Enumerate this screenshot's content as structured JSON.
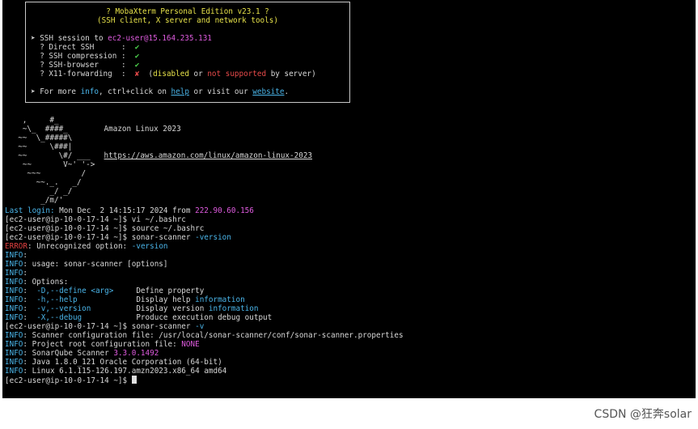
{
  "banner": {
    "title": "? MobaXterm Personal Edition v23.1 ?",
    "subtitle": "(SSH client, X server and network tools)",
    "session_prefix": "➤ SSH session to ",
    "session_target": "ec2-user@15.164.235.131",
    "rows": [
      {
        "label": "  ? Direct SSH      :  ",
        "mark": "✔"
      },
      {
        "label": "  ? SSH compression :  ",
        "mark": "✔"
      },
      {
        "label": "  ? SSH-browser     :  ",
        "mark": "✔"
      }
    ],
    "x11_label": "  ? X11-forwarding  :  ",
    "x11_mark": "✘",
    "x11_open": "  (",
    "x11_disabled": "disabled",
    "x11_or": " or ",
    "x11_not_supported": "not supported",
    "x11_close": " by server)",
    "more_prefix": "➤ For more ",
    "more_info": "info",
    "more_mid": ", ctrl+click on ",
    "more_help": "help",
    "more_mid2": " or visit our ",
    "more_website": "website",
    "more_end": "."
  },
  "ascii_art": [
    "   ,     #_",
    "   ~\\_  ####_        Amazon Linux 2023",
    "  ~~  \\_#####\\",
    "  ~~     \\###|",
    "  ~~       \\#/ ___   https://aws.amazon.com/linux/amazon-linux-2023",
    "   ~~       V~' '->",
    "    ~~~         /",
    "      ~~._.   _/",
    "         _/ _/",
    "       _/m/'"
  ],
  "last_login": {
    "label": "Last login:",
    "text": " Mon Dec  2 14:15:17 2024 from ",
    "ip": "222.90.60.156"
  },
  "prompt": "[ec2-user@ip-10-0-17-14 ~]$ ",
  "cmd1": "vi ~/.bashrc",
  "cmd2": "source ~/.bashrc",
  "cmd3": "sonar-scanner",
  "cmd3_flag": " -version",
  "error_label": "ERROR",
  "error_text": ": Unrecognized option: ",
  "error_flag": "-version",
  "info_label": "INFO",
  "usage_text": ": usage: sonar-scanner [options]",
  "options_text": ": Options:",
  "opt_define_flag": "-D,--define <arg>",
  "opt_define_desc": "     Define property",
  "opt_help_flag": "-h,--help",
  "opt_help_desc": "             Display help ",
  "opt_version_flag": "-v,--version",
  "opt_version_desc": "          Display version ",
  "information_word": "information",
  "opt_debug_flag": "-X,--debug",
  "opt_debug_desc": "            Produce execution debug output",
  "cmd4": "sonar-scanner",
  "cmd4_flag": " -v",
  "conf_text": ": Scanner configuration file: /usr/local/sonar-scanner/conf/sonar-scanner.properties",
  "project_text": ": Project root configuration file: ",
  "none_word": "NONE",
  "sq_text": ": SonarQube Scanner ",
  "sq_version": "3.3.0.1492",
  "java_text": ": Java 1.8.0_121 Oracle Corporation (64-bit)",
  "linux_text": ": Linux 6.1.115-126.197.amzn2023.x86_64 amd64",
  "watermark": "CSDN @狂奔solar"
}
